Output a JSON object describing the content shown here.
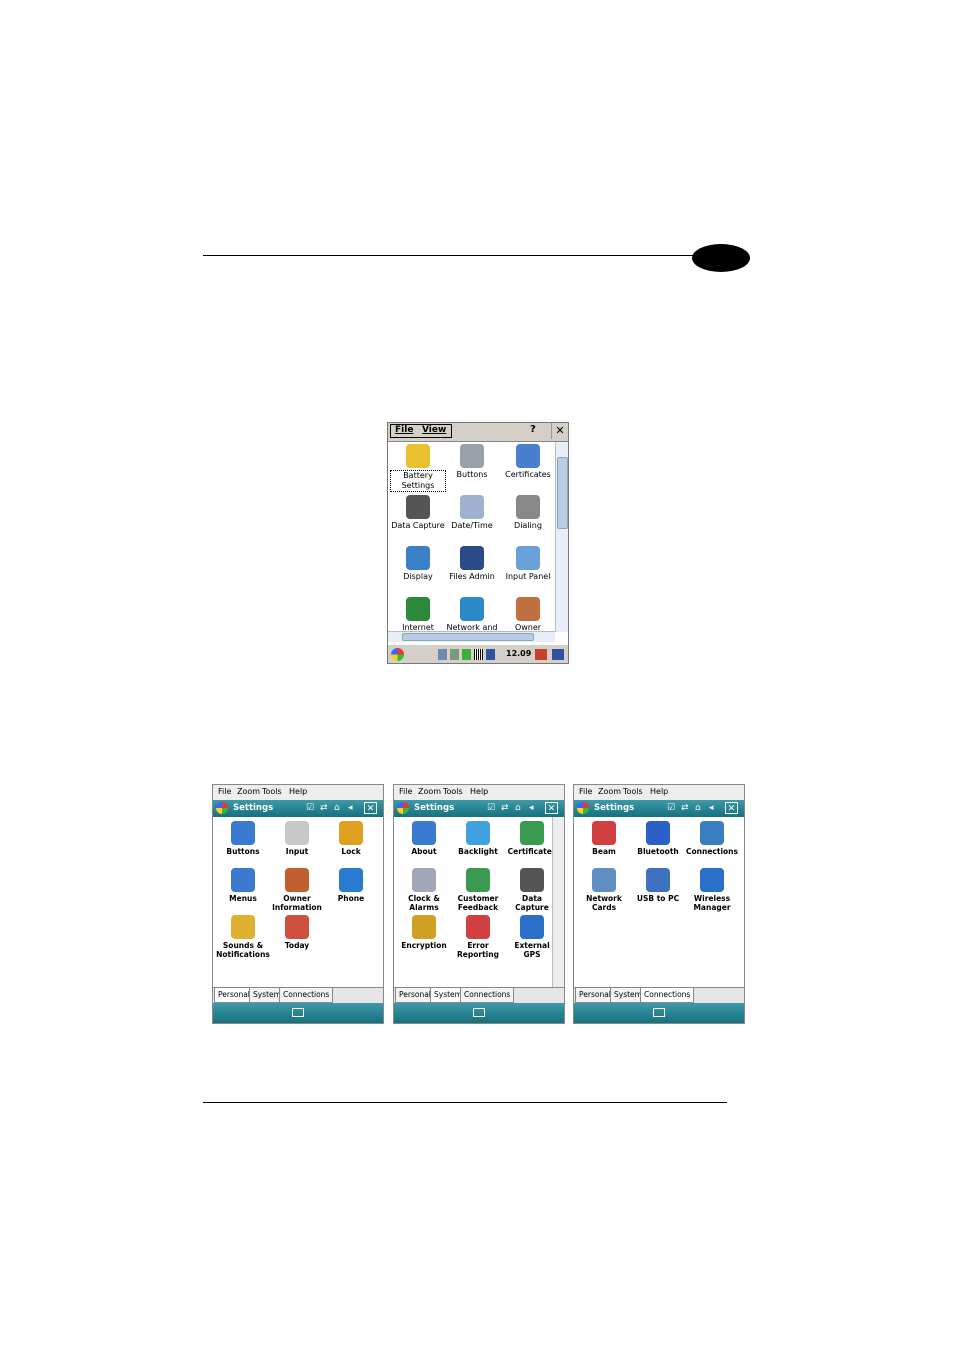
{
  "ce": {
    "menu": [
      "File",
      "View"
    ],
    "help_icon": "help-icon",
    "close": "✕",
    "items": [
      {
        "label": "Battery Settings",
        "icon": "battery-icon",
        "color": "#e8c030"
      },
      {
        "label": "Buttons",
        "icon": "buttons-icon",
        "color": "#9aa0a8"
      },
      {
        "label": "Certificates",
        "icon": "certificates-icon",
        "color": "#4a7fd0"
      },
      {
        "label": "Data Capture",
        "icon": "data-capture-icon",
        "color": "#555"
      },
      {
        "label": "Date/Time",
        "icon": "clock-icon",
        "color": "#9fb3d0"
      },
      {
        "label": "Dialing",
        "icon": "phone-icon",
        "color": "#888"
      },
      {
        "label": "Display",
        "icon": "display-icon",
        "color": "#3a80c8"
      },
      {
        "label": "Files Admin",
        "icon": "files-admin-icon",
        "color": "#2a4a8a"
      },
      {
        "label": "Input Panel",
        "icon": "input-panel-icon",
        "color": "#6aa0d8"
      },
      {
        "label": "Internet",
        "icon": "internet-icon",
        "color": "#2a8a3a"
      },
      {
        "label": "Network and",
        "icon": "network-icon",
        "color": "#2a8ac8"
      },
      {
        "label": "Owner",
        "icon": "owner-icon",
        "color": "#c07040"
      }
    ],
    "clock": "12.09"
  },
  "wm": [
    {
      "menu": [
        "File",
        "Zoom",
        "Tools",
        "Help"
      ],
      "title": "Settings",
      "items": [
        {
          "label": "Buttons",
          "icon": "buttons-icon",
          "color": "#3a7ad0"
        },
        {
          "label": "Input",
          "icon": "keyboard-icon",
          "color": "#c8c8c8"
        },
        {
          "label": "Lock",
          "icon": "key-icon",
          "color": "#e0a020"
        },
        {
          "label": "Menus",
          "icon": "menus-icon",
          "color": "#3a7ad0"
        },
        {
          "label": "Owner Information",
          "icon": "owner-icon",
          "color": "#c06030"
        },
        {
          "label": "Phone",
          "icon": "phone-icon",
          "color": "#2a7ad0"
        },
        {
          "label": "Sounds & Notifications",
          "icon": "sound-icon",
          "color": "#e0b030"
        },
        {
          "label": "Today",
          "icon": "today-icon",
          "color": "#d05040"
        }
      ],
      "tabs": [
        "Personal",
        "System",
        "Connections"
      ],
      "active_tab": 0
    },
    {
      "menu": [
        "File",
        "Zoom",
        "Tools",
        "Help"
      ],
      "title": "Settings",
      "items": [
        {
          "label": "About",
          "icon": "about-icon",
          "color": "#3a7ad0"
        },
        {
          "label": "Backlight",
          "icon": "backlight-icon",
          "color": "#40a0e0"
        },
        {
          "label": "Certificates",
          "icon": "certificates-icon",
          "color": "#3a9a50"
        },
        {
          "label": "Clock & Alarms",
          "icon": "clock-icon",
          "color": "#a0a8b8"
        },
        {
          "label": "Customer Feedback",
          "icon": "feedback-icon",
          "color": "#3a9a50"
        },
        {
          "label": "Data Capture",
          "icon": "data-capture-icon",
          "color": "#555"
        },
        {
          "label": "Encryption",
          "icon": "encryption-icon",
          "color": "#d0a020"
        },
        {
          "label": "Error Reporting",
          "icon": "error-icon",
          "color": "#d04040"
        },
        {
          "label": "External GPS",
          "icon": "gps-icon",
          "color": "#2a70c8"
        }
      ],
      "tabs": [
        "Personal",
        "System",
        "Connections"
      ],
      "active_tab": 1
    },
    {
      "menu": [
        "File",
        "Zoom",
        "Tools",
        "Help"
      ],
      "title": "Settings",
      "items": [
        {
          "label": "Beam",
          "icon": "beam-icon",
          "color": "#d04040"
        },
        {
          "label": "Bluetooth",
          "icon": "bluetooth-icon",
          "color": "#2a60c8"
        },
        {
          "label": "Connections",
          "icon": "connections-icon",
          "color": "#3a80c0"
        },
        {
          "label": "Network Cards",
          "icon": "network-card-icon",
          "color": "#6090c0"
        },
        {
          "label": "USB to PC",
          "icon": "usb-icon",
          "color": "#4070c0"
        },
        {
          "label": "Wireless Manager",
          "icon": "wireless-icon",
          "color": "#2a70c8"
        }
      ],
      "tabs": [
        "Personal",
        "System",
        "Connections"
      ],
      "active_tab": 2
    }
  ]
}
